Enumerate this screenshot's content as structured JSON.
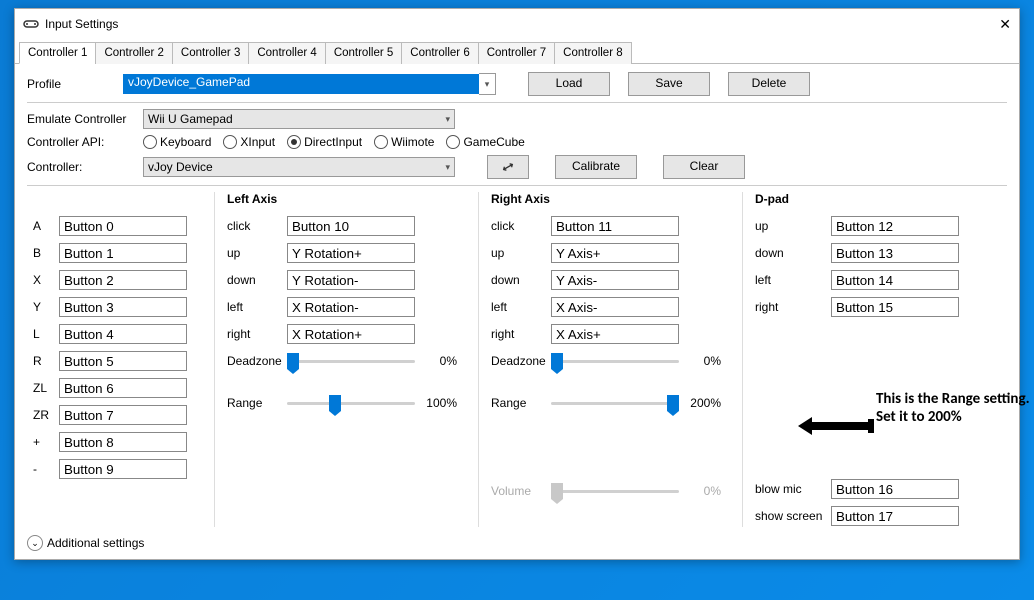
{
  "window": {
    "title": "Input Settings"
  },
  "tabs": [
    "Controller 1",
    "Controller 2",
    "Controller 3",
    "Controller 4",
    "Controller 5",
    "Controller 6",
    "Controller 7",
    "Controller 8"
  ],
  "activeTab": 0,
  "profile": {
    "label": "Profile",
    "value": "vJoyDevice_GamePad",
    "load": "Load",
    "save": "Save",
    "delete": "Delete"
  },
  "emulate": {
    "label": "Emulate Controller",
    "value": "Wii U Gamepad"
  },
  "api": {
    "label": "Controller API:",
    "options": [
      "Keyboard",
      "XInput",
      "DirectInput",
      "Wiimote",
      "GameCube"
    ],
    "selected": 2
  },
  "controller": {
    "label": "Controller:",
    "value": "vJoy Device",
    "calibrate": "Calibrate",
    "clear": "Clear"
  },
  "buttonCol": {
    "rows": [
      {
        "l": "A",
        "v": "Button 0"
      },
      {
        "l": "B",
        "v": "Button 1"
      },
      {
        "l": "X",
        "v": "Button 2"
      },
      {
        "l": "Y",
        "v": "Button 3"
      },
      {
        "l": "L",
        "v": "Button 4"
      },
      {
        "l": "R",
        "v": "Button 5"
      },
      {
        "l": "ZL",
        "v": "Button 6"
      },
      {
        "l": "ZR",
        "v": "Button 7"
      },
      {
        "l": "+",
        "v": "Button 8"
      },
      {
        "l": "-",
        "v": "Button 9"
      }
    ]
  },
  "leftAxis": {
    "head": "Left Axis",
    "rows": [
      {
        "l": "click",
        "v": "Button 10"
      },
      {
        "l": "up",
        "v": "Y Rotation+"
      },
      {
        "l": "down",
        "v": "Y Rotation-"
      },
      {
        "l": "left",
        "v": "X Rotation-"
      },
      {
        "l": "right",
        "v": "X Rotation+"
      }
    ],
    "deadzone": {
      "label": "Deadzone",
      "pct": "0%",
      "pos": 0
    },
    "range": {
      "label": "Range",
      "pct": "100%",
      "pos": 42
    }
  },
  "rightAxis": {
    "head": "Right Axis",
    "rows": [
      {
        "l": "click",
        "v": "Button 11"
      },
      {
        "l": "up",
        "v": "Y Axis+"
      },
      {
        "l": "down",
        "v": "Y Axis-"
      },
      {
        "l": "left",
        "v": "X Axis-"
      },
      {
        "l": "right",
        "v": "X Axis+"
      }
    ],
    "deadzone": {
      "label": "Deadzone",
      "pct": "0%",
      "pos": 0
    },
    "range": {
      "label": "Range",
      "pct": "200%",
      "pos": 116
    },
    "volume": {
      "label": "Volume",
      "pct": "0%",
      "pos": 0
    }
  },
  "dpad": {
    "head": "D-pad",
    "rows": [
      {
        "l": "up",
        "v": "Button 12"
      },
      {
        "l": "down",
        "v": "Button 13"
      },
      {
        "l": "left",
        "v": "Button 14"
      },
      {
        "l": "right",
        "v": "Button 15"
      }
    ],
    "extra": [
      {
        "l": "blow mic",
        "v": "Button 16"
      },
      {
        "l": "show screen",
        "v": "Button 17"
      }
    ]
  },
  "additional": "Additional settings",
  "annotation": "This is the Range setting. Set it to 200%"
}
